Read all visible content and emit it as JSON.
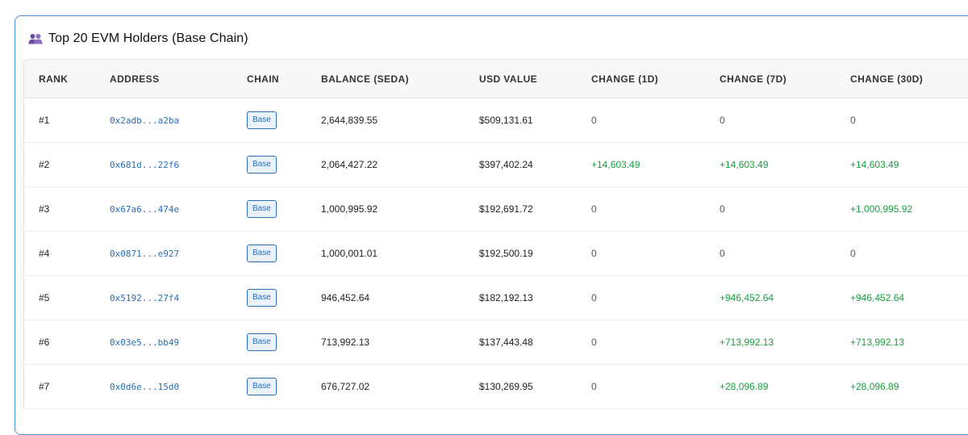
{
  "title": "Top 20 EVM Holders (Base Chain)",
  "icon": "users-icon",
  "colors": {
    "accent": "#2a6fb8",
    "positive": "#18a03f",
    "border": "#4a90d9"
  },
  "table": {
    "columns": [
      "RANK",
      "ADDRESS",
      "CHAIN",
      "BALANCE (SEDA)",
      "USD VALUE",
      "CHANGE (1D)",
      "CHANGE (7D)",
      "CHANGE (30D)"
    ],
    "rows": [
      {
        "rank": "#1",
        "address": "0x2adb...a2ba",
        "chain": "Base",
        "balance": "2,644,839.55",
        "usd": "$509,131.61",
        "c1": "0",
        "c7": "0",
        "c30": "0"
      },
      {
        "rank": "#2",
        "address": "0x681d...22f6",
        "chain": "Base",
        "balance": "2,064,427.22",
        "usd": "$397,402.24",
        "c1": "+14,603.49",
        "c7": "+14,603.49",
        "c30": "+14,603.49"
      },
      {
        "rank": "#3",
        "address": "0x67a6...474e",
        "chain": "Base",
        "balance": "1,000,995.92",
        "usd": "$192,691.72",
        "c1": "0",
        "c7": "0",
        "c30": "+1,000,995.92"
      },
      {
        "rank": "#4",
        "address": "0x0871...e927",
        "chain": "Base",
        "balance": "1,000,001.01",
        "usd": "$192,500.19",
        "c1": "0",
        "c7": "0",
        "c30": "0"
      },
      {
        "rank": "#5",
        "address": "0x5192...27f4",
        "chain": "Base",
        "balance": "946,452.64",
        "usd": "$182,192.13",
        "c1": "0",
        "c7": "+946,452.64",
        "c30": "+946,452.64"
      },
      {
        "rank": "#6",
        "address": "0x03e5...bb49",
        "chain": "Base",
        "balance": "713,992.13",
        "usd": "$137,443.48",
        "c1": "0",
        "c7": "+713,992.13",
        "c30": "+713,992.13"
      },
      {
        "rank": "#7",
        "address": "0x0d6e...15d0",
        "chain": "Base",
        "balance": "676,727.02",
        "usd": "$130,269.95",
        "c1": "0",
        "c7": "+28,096.89",
        "c30": "+28,096.89"
      }
    ]
  }
}
